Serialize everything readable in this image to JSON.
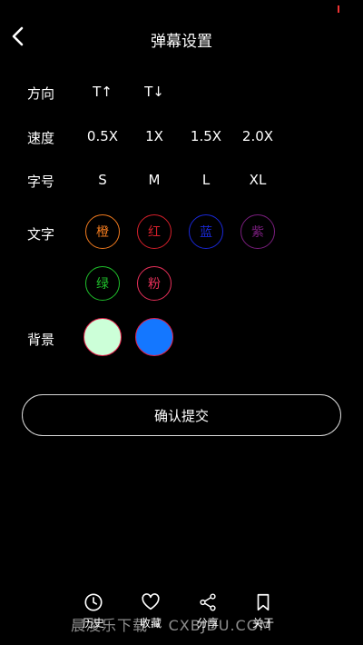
{
  "header": {
    "title": "弹幕设置"
  },
  "direction": {
    "label": "方向",
    "options": [
      "T↑",
      "T↓"
    ]
  },
  "speed": {
    "label": "速度",
    "options": [
      "0.5X",
      "1X",
      "1.5X",
      "2.0X"
    ]
  },
  "size": {
    "label": "字号",
    "options": [
      "S",
      "M",
      "L",
      "XL"
    ]
  },
  "text_color": {
    "label": "文字",
    "options": [
      {
        "label": "橙",
        "color": "#f07a1e"
      },
      {
        "label": "红",
        "color": "#d41f2a"
      },
      {
        "label": "蓝",
        "color": "#1a28d8"
      },
      {
        "label": "紫",
        "color": "#7a1e7e"
      },
      {
        "label": "绿",
        "color": "#1fbf2b"
      },
      {
        "label": "粉",
        "color": "#e8305a"
      }
    ]
  },
  "background": {
    "label": "背景",
    "options": [
      {
        "color": "#ccffd8"
      },
      {
        "color": "#1477ff"
      }
    ]
  },
  "submit": {
    "label": "确认提交"
  },
  "bottom_nav": [
    {
      "label": "历史",
      "icon": "clock-icon"
    },
    {
      "label": "收藏",
      "icon": "heart-icon"
    },
    {
      "label": "分享",
      "icon": "share-icon"
    },
    {
      "label": "关于",
      "icon": "bookmark-icon"
    }
  ],
  "watermark": "晨凌乐下载 • CXBJDU.COM"
}
